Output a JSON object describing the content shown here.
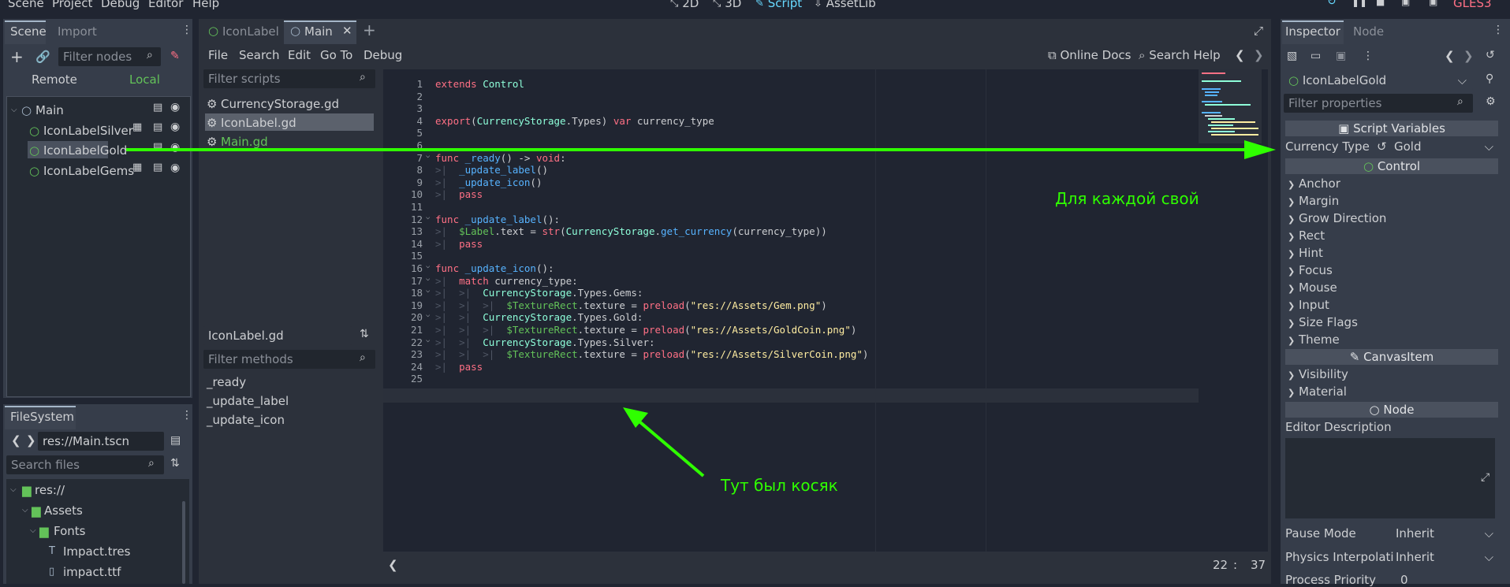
{
  "menubar": {
    "items": [
      "Scene",
      "Project",
      "Debug",
      "Editor",
      "Help"
    ],
    "workspaces": [
      {
        "label": "2D",
        "icon": "2d-icon",
        "active": false
      },
      {
        "label": "3D",
        "icon": "3d-icon",
        "active": false
      },
      {
        "label": "Script",
        "icon": "script-icon",
        "active": true
      },
      {
        "label": "AssetLib",
        "icon": "assetlib-icon",
        "active": false
      }
    ],
    "renderer": "GLES3"
  },
  "scene_dock": {
    "tabs": [
      "Scene",
      "Import"
    ],
    "filter_placeholder": "Filter nodes",
    "remote_label": "Remote",
    "local_label": "Local",
    "tree": [
      {
        "name": "Main",
        "level": 0
      },
      {
        "name": "IconLabelSilver",
        "level": 1
      },
      {
        "name": "IconLabelGold",
        "level": 1,
        "selected": true
      },
      {
        "name": "IconLabelGems",
        "level": 1
      }
    ]
  },
  "filesystem": {
    "tab": "FileSystem",
    "path": "res://Main.tscn",
    "search_placeholder": "Search files",
    "tree": [
      {
        "name": "res://",
        "level": 0
      },
      {
        "name": "Assets",
        "level": 1
      },
      {
        "name": "Fonts",
        "level": 2
      },
      {
        "name": "Impact.tres",
        "level": 3
      },
      {
        "name": "impact.ttf",
        "level": 3
      }
    ]
  },
  "editor_tabs": [
    {
      "label": "IconLabel",
      "active": false
    },
    {
      "label": "Main",
      "active": true
    }
  ],
  "script_menu": [
    "File",
    "Search",
    "Edit",
    "Go To",
    "Debug"
  ],
  "online_docs": "Online Docs",
  "search_help": "Search Help",
  "scripts_panel": {
    "filter_placeholder": "Filter scripts",
    "scripts": [
      {
        "name": "CurrencyStorage.gd",
        "selected": false
      },
      {
        "name": "IconLabel.gd",
        "selected": true
      },
      {
        "name": "Main.gd",
        "selected": false,
        "highlight": true
      }
    ],
    "current_script": "IconLabel.gd",
    "methods_placeholder": "Filter methods",
    "methods": [
      "_ready",
      "_update_label",
      "_update_icon"
    ]
  },
  "code": {
    "lines": [
      "extends Control",
      "",
      "",
      "export(CurrencyStorage.Types) var currency_type",
      "",
      "",
      "func _ready() -> void:",
      "\t_update_label()",
      "\t_update_icon()",
      "\tpass",
      "",
      "func _update_label():",
      "\t$Label.text = str(CurrencyStorage.get_currency(currency_type))",
      "\tpass",
      "",
      "func _update_icon():",
      "\tmatch currency_type:",
      "\t\tCurrencyStorage.Types.Gems:",
      "\t\t\t$TextureRect.texture = preload(\"res://Assets/Gem.png\")",
      "\t\tCurrencyStorage.Types.Gold:",
      "\t\t\t$TextureRect.texture = preload(\"res://Assets/GoldCoin.png\")",
      "\t\tCurrencyStorage.Types.Silver:",
      "\t\t\t$TextureRect.texture = preload(\"res://Assets/SilverCoin.png\")",
      "\tpass",
      ""
    ],
    "current_line": 22,
    "status_line": "22",
    "status_col": "37",
    "status_sep": ":"
  },
  "annotations": {
    "right_note": "Для каждой свой",
    "bottom_note": "Тут был косяк",
    "color": "#2fff00"
  },
  "inspector": {
    "tabs": [
      "Inspector",
      "Node"
    ],
    "node_name": "IconLabelGold",
    "filter_placeholder": "Filter properties",
    "sections": {
      "script_variables": "Script Variables",
      "control": "Control",
      "canvas_item": "CanvasItem",
      "node": "Node"
    },
    "currency_type_label": "Currency Type",
    "currency_type_value": "Gold",
    "control_groups": [
      "Anchor",
      "Margin",
      "Grow Direction",
      "Rect",
      "Hint",
      "Focus",
      "Mouse",
      "Input",
      "Size Flags",
      "Theme"
    ],
    "canvas_groups": [
      "Visibility",
      "Material"
    ],
    "editor_description": "Editor Description",
    "pause_mode_label": "Pause Mode",
    "pause_mode_value": "Inherit",
    "physics_label": "Physics Interpolati",
    "physics_value": "Inherit",
    "priority_label": "Process Priority",
    "priority_value": "0"
  }
}
